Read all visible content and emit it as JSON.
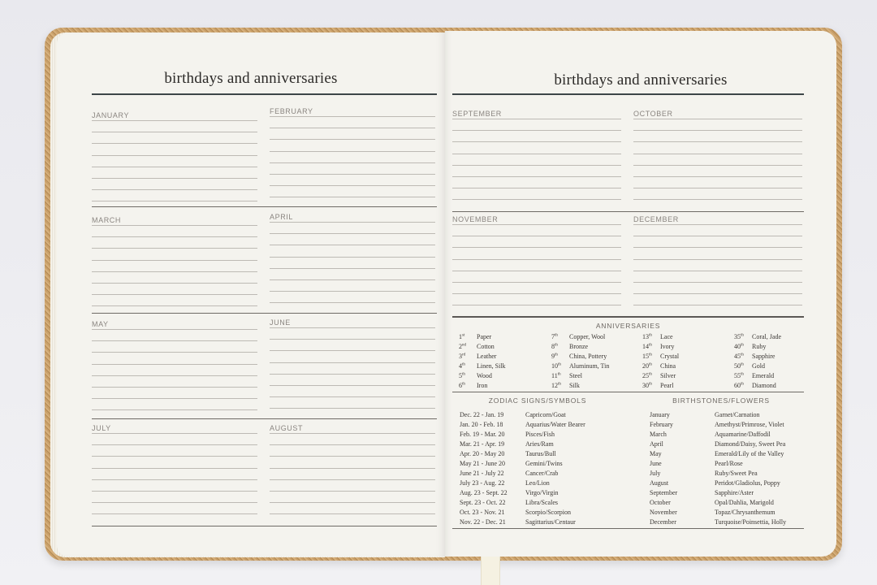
{
  "left_page": {
    "title": "birthdays and anniversaries",
    "months": [
      {
        "label": "JANUARY"
      },
      {
        "label": "FEBRUARY"
      },
      {
        "label": "MARCH"
      },
      {
        "label": "APRIL"
      },
      {
        "label": "MAY"
      },
      {
        "label": "JUNE"
      },
      {
        "label": "JULY"
      },
      {
        "label": "AUGUST"
      }
    ]
  },
  "right_page": {
    "title": "birthdays and anniversaries",
    "months": [
      {
        "label": "SEPTEMBER"
      },
      {
        "label": "OCTOBER"
      },
      {
        "label": "NOVEMBER"
      },
      {
        "label": "DECEMBER"
      }
    ],
    "anniversaries": {
      "heading": "ANNIVERSARIES",
      "columns": [
        [
          {
            "n": "1",
            "suf": "st",
            "gift": "Paper"
          },
          {
            "n": "2",
            "suf": "nd",
            "gift": "Cotton"
          },
          {
            "n": "3",
            "suf": "rd",
            "gift": "Leather"
          },
          {
            "n": "4",
            "suf": "th",
            "gift": "Linen, Silk"
          },
          {
            "n": "5",
            "suf": "th",
            "gift": "Wood"
          },
          {
            "n": "6",
            "suf": "th",
            "gift": "Iron"
          }
        ],
        [
          {
            "n": "7",
            "suf": "th",
            "gift": "Copper, Wool"
          },
          {
            "n": "8",
            "suf": "th",
            "gift": "Bronze"
          },
          {
            "n": "9",
            "suf": "th",
            "gift": "China, Pottery"
          },
          {
            "n": "10",
            "suf": "th",
            "gift": "Aluminum, Tin"
          },
          {
            "n": "11",
            "suf": "th",
            "gift": "Steel"
          },
          {
            "n": "12",
            "suf": "th",
            "gift": "Silk"
          }
        ],
        [
          {
            "n": "13",
            "suf": "th",
            "gift": "Lace"
          },
          {
            "n": "14",
            "suf": "th",
            "gift": "Ivory"
          },
          {
            "n": "15",
            "suf": "th",
            "gift": "Crystal"
          },
          {
            "n": "20",
            "suf": "th",
            "gift": "China"
          },
          {
            "n": "25",
            "suf": "th",
            "gift": "Silver"
          },
          {
            "n": "30",
            "suf": "th",
            "gift": "Pearl"
          }
        ],
        [
          {
            "n": "35",
            "suf": "th",
            "gift": "Coral, Jade"
          },
          {
            "n": "40",
            "suf": "th",
            "gift": "Ruby"
          },
          {
            "n": "45",
            "suf": "th",
            "gift": "Sapphire"
          },
          {
            "n": "50",
            "suf": "th",
            "gift": "Gold"
          },
          {
            "n": "55",
            "suf": "th",
            "gift": "Emerald"
          },
          {
            "n": "60",
            "suf": "th",
            "gift": "Diamond"
          }
        ]
      ]
    },
    "zodiac": {
      "heading": "ZODIAC SIGNS/SYMBOLS",
      "rows": [
        {
          "dates": "Dec. 22 - Jan. 19",
          "sign": "Capricorn/Goat"
        },
        {
          "dates": "Jan. 20 - Feb. 18",
          "sign": "Aquarius/Water Bearer"
        },
        {
          "dates": "Feb. 19 - Mar. 20",
          "sign": "Pisces/Fish"
        },
        {
          "dates": "Mar. 21 - Apr. 19",
          "sign": "Aries/Ram"
        },
        {
          "dates": "Apr. 20 - May 20",
          "sign": "Taurus/Bull"
        },
        {
          "dates": "May 21 - June 20",
          "sign": "Gemini/Twins"
        },
        {
          "dates": "June 21 - July 22",
          "sign": "Cancer/Crab"
        },
        {
          "dates": "July 23 - Aug. 22",
          "sign": "Leo/Lion"
        },
        {
          "dates": "Aug. 23 - Sept. 22",
          "sign": "Virgo/Virgin"
        },
        {
          "dates": "Sept. 23 - Oct. 22",
          "sign": "Libra/Scales"
        },
        {
          "dates": "Oct. 23 - Nov. 21",
          "sign": "Scorpio/Scorpion"
        },
        {
          "dates": "Nov. 22 - Dec. 21",
          "sign": "Sagittarius/Centaur"
        }
      ]
    },
    "birthstones": {
      "heading": "BIRTHSTONES/FLOWERS",
      "rows": [
        {
          "month": "January",
          "stone": "Garnet/Carnation"
        },
        {
          "month": "February",
          "stone": "Amethyst/Primrose, Violet"
        },
        {
          "month": "March",
          "stone": "Aquamarine/Daffodil"
        },
        {
          "month": "April",
          "stone": "Diamond/Daisy, Sweet Pea"
        },
        {
          "month": "May",
          "stone": "Emerald/Lily of the Valley"
        },
        {
          "month": "June",
          "stone": "Pearl/Rose"
        },
        {
          "month": "July",
          "stone": "Ruby/Sweet Pea"
        },
        {
          "month": "August",
          "stone": "Peridot/Gladiolus, Poppy"
        },
        {
          "month": "September",
          "stone": "Sapphire/Aster"
        },
        {
          "month": "October",
          "stone": "Opal/Dahlia, Marigold"
        },
        {
          "month": "November",
          "stone": "Topaz/Chrysanthemum"
        },
        {
          "month": "December",
          "stone": "Turquoise/Poinsettia, Holly"
        }
      ]
    }
  }
}
